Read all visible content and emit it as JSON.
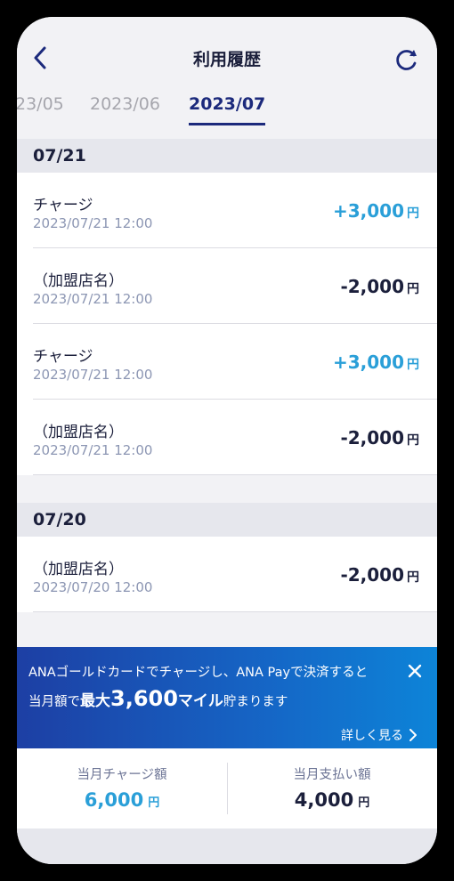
{
  "header": {
    "title": "利用履歴"
  },
  "months": [
    "23/05",
    "2023/06",
    "2023/07"
  ],
  "groups": [
    {
      "date": "07/21",
      "items": [
        {
          "name": "チャージ",
          "datetime": "2023/07/21 12:00",
          "amount": "+3,000",
          "unit": "円",
          "type": "plus"
        },
        {
          "name": "（加盟店名）",
          "datetime": "2023/07/21 12:00",
          "amount": "-2,000",
          "unit": "円",
          "type": "minus"
        },
        {
          "name": "チャージ",
          "datetime": "2023/07/21 12:00",
          "amount": "+3,000",
          "unit": "円",
          "type": "plus"
        },
        {
          "name": "（加盟店名）",
          "datetime": "2023/07/21 12:00",
          "amount": "-2,000",
          "unit": "円",
          "type": "minus"
        }
      ]
    },
    {
      "date": "07/20",
      "items": [
        {
          "name": "（加盟店名）",
          "datetime": "2023/07/20 12:00",
          "amount": "-2,000",
          "unit": "円",
          "type": "minus"
        }
      ]
    }
  ],
  "banner": {
    "line1": "ANAゴールドカードでチャージし、ANA Payで決済すると",
    "line2_prefix": "当月額で",
    "line2_big": "最大",
    "line2_huge": "3,600",
    "line2_big2": "マイル",
    "line2_suffix": "貯まります",
    "more": "詳しく見る"
  },
  "summary": {
    "charge_label": "当月チャージ額",
    "charge_value": "6,000",
    "payment_label": "当月支払い額",
    "payment_value": "4,000",
    "unit": "円"
  },
  "colors": {
    "plus": "#2a9fd8",
    "minus": "#1b1f3b",
    "accent": "#1c2a7c"
  }
}
